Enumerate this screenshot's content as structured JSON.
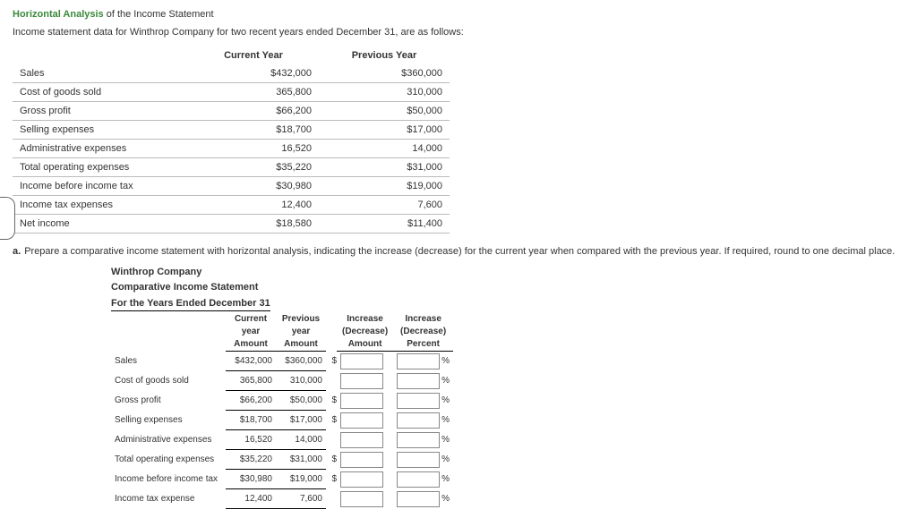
{
  "header": {
    "green_title": "Horizontal Analysis",
    "plain_title": " of the Income Statement",
    "intro": "Income statement data for Winthrop Company for two recent years ended December 31, are as follows:"
  },
  "table1": {
    "col_current": "Current Year",
    "col_previous": "Previous Year",
    "rows": [
      {
        "label": "Sales",
        "cur": "$432,000",
        "prev": "$360,000"
      },
      {
        "label": "Cost of goods sold",
        "cur": "365,800",
        "prev": "310,000"
      },
      {
        "label": "Gross profit",
        "cur": "$66,200",
        "prev": "$50,000"
      },
      {
        "label": "Selling expenses",
        "cur": "$18,700",
        "prev": "$17,000"
      },
      {
        "label": "Administrative expenses",
        "cur": "16,520",
        "prev": "14,000"
      },
      {
        "label": "Total operating expenses",
        "cur": "$35,220",
        "prev": "$31,000"
      },
      {
        "label": "Income before income tax",
        "cur": "$30,980",
        "prev": "$19,000"
      },
      {
        "label": "Income tax expenses",
        "cur": "12,400",
        "prev": "7,600"
      },
      {
        "label": "Net income",
        "cur": "$18,580",
        "prev": "$11,400"
      }
    ]
  },
  "instruction": {
    "letter": "a.",
    "text": "Prepare a comparative income statement with horizontal analysis, indicating the increase (decrease) for the current year when compared with the previous year. If required, round to one decimal place."
  },
  "comp": {
    "company": "Winthrop Company",
    "statement": "Comparative Income Statement",
    "period": "For the Years Ended December 31",
    "headers": {
      "c1a": "Current",
      "c1b": "year",
      "c1c": "Amount",
      "c2a": "Previous",
      "c2b": "year",
      "c2c": "Amount",
      "c3a": "Increase",
      "c3b": "(Decrease)",
      "c3c": "Amount",
      "c4a": "Increase",
      "c4b": "(Decrease)",
      "c4c": "Percent"
    },
    "rows": [
      {
        "label": "Sales",
        "cur": "$432,000",
        "prev": "$360,000",
        "dollar": "$"
      },
      {
        "label": "Cost of goods sold",
        "cur": "365,800",
        "prev": "310,000",
        "dollar": ""
      },
      {
        "label": "Gross profit",
        "cur": "$66,200",
        "prev": "$50,000",
        "dollar": "$"
      },
      {
        "label": "Selling expenses",
        "cur": "$18,700",
        "prev": "$17,000",
        "dollar": "$"
      },
      {
        "label": "Administrative expenses",
        "cur": "16,520",
        "prev": "14,000",
        "dollar": ""
      },
      {
        "label": "Total operating expenses",
        "cur": "$35,220",
        "prev": "$31,000",
        "dollar": "$"
      },
      {
        "label": "Income before income tax",
        "cur": "$30,980",
        "prev": "$19,000",
        "dollar": "$"
      },
      {
        "label": "Income tax expense",
        "cur": "12,400",
        "prev": "7,600",
        "dollar": ""
      }
    ],
    "pct_sign": "%"
  }
}
